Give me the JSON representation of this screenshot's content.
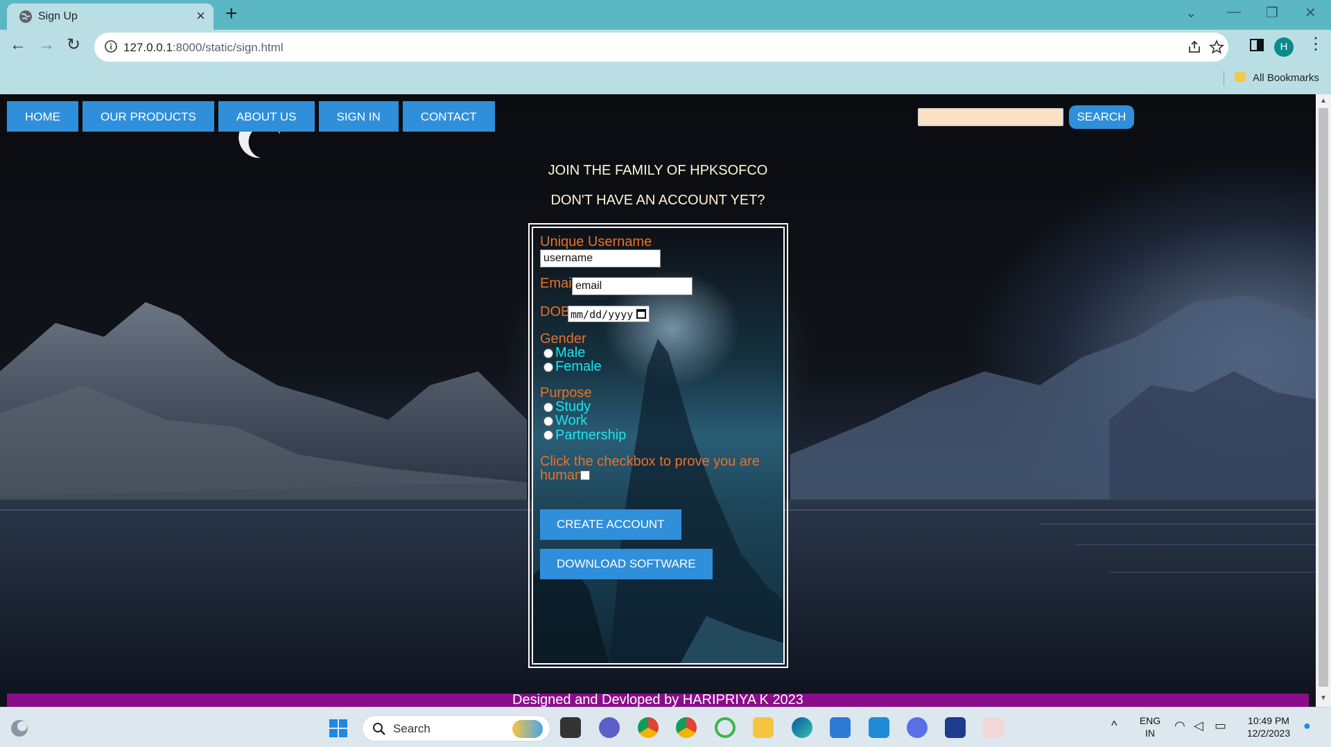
{
  "browser": {
    "tab_title": "Sign Up",
    "tab_close": "×",
    "new_tab": "+",
    "url_host": "127.0.0.1",
    "url_rest": ":8000/static/sign.html",
    "bookmarks_label": "All Bookmarks",
    "profile_initial": "H"
  },
  "nav": {
    "items": [
      "HOME",
      "OUR PRODUCTS",
      "ABOUT US",
      "SIGN IN",
      "CONTACT"
    ],
    "search_button": "SEARCH"
  },
  "page": {
    "heading1": "JOIN THE FAMILY OF HPKSOFCO",
    "heading2": "DON'T HAVE AN ACCOUNT YET?"
  },
  "form": {
    "username_label": "Unique Username",
    "username_value": "username",
    "email_label": "Email",
    "email_value": "email",
    "dob_label": "DOB",
    "dob_placeholder": "mm/dd/yyyy",
    "gender_label": "Gender",
    "gender_options": [
      "Male",
      "Female"
    ],
    "purpose_label": "Purpose",
    "purpose_options": [
      "Study",
      "Work",
      "Partnership"
    ],
    "captcha_line1": "Click the checkbox to prove you are",
    "captcha_line2": "human",
    "create_button": "CREATE ACCOUNT",
    "download_button": "DOWNLOAD SOFTWARE"
  },
  "footer": {
    "text": "Designed and Devloped by HARIPRIYA K 2023"
  },
  "taskbar": {
    "search_label": "Search",
    "lang_line1": "ENG",
    "lang_line2": "IN",
    "time": "10:49 PM",
    "date": "12/2/2023"
  },
  "colors": {
    "accent_blue": "#2f8fda",
    "label_orange": "#e8722a",
    "option_cyan": "#19e6ee",
    "footer_purple": "#8a0d8a",
    "tab_teal": "#5cb7c4"
  }
}
